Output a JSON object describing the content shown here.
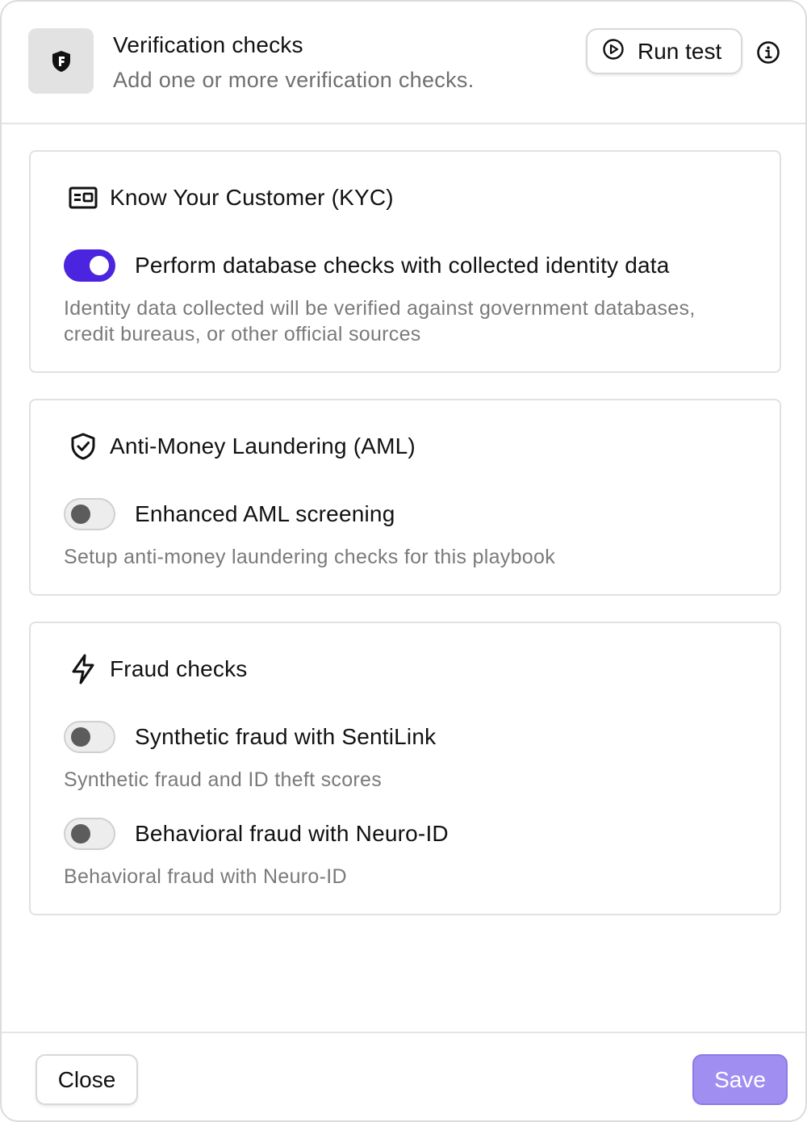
{
  "header": {
    "title": "Verification checks",
    "subtitle": "Add one or more verification checks.",
    "logo_icon": "shield-f-logo-icon",
    "run_test_label": "Run test",
    "run_test_icon": "play-circle-icon",
    "info_icon": "info-circle-icon"
  },
  "sections": {
    "kyc": {
      "title": "Know Your Customer (KYC)",
      "icon": "id-card-icon",
      "toggles": [
        {
          "label": "Perform database checks with collected identity data",
          "enabled": true,
          "description": "Identity data collected will be verified against government databases, credit bureaus, or other official sources"
        }
      ]
    },
    "aml": {
      "title": "Anti-Money Laundering (AML)",
      "icon": "shield-check-icon",
      "toggles": [
        {
          "label": "Enhanced AML screening",
          "enabled": false,
          "description": "Setup anti-money laundering checks for this playbook"
        }
      ]
    },
    "fraud": {
      "title": "Fraud checks",
      "icon": "lightning-bolt-icon",
      "toggles": [
        {
          "label": "Synthetic fraud with SentiLink",
          "enabled": false,
          "description": "Synthetic fraud and ID theft scores"
        },
        {
          "label": "Behavioral fraud with Neuro-ID",
          "enabled": false,
          "description": "Behavioral fraud with Neuro-ID"
        }
      ]
    }
  },
  "footer": {
    "close_label": "Close",
    "save_label": "Save"
  },
  "colors": {
    "toggle_on": "#4a24df",
    "save_button": "#a08ff0",
    "muted_text": "#7a7a7a"
  }
}
